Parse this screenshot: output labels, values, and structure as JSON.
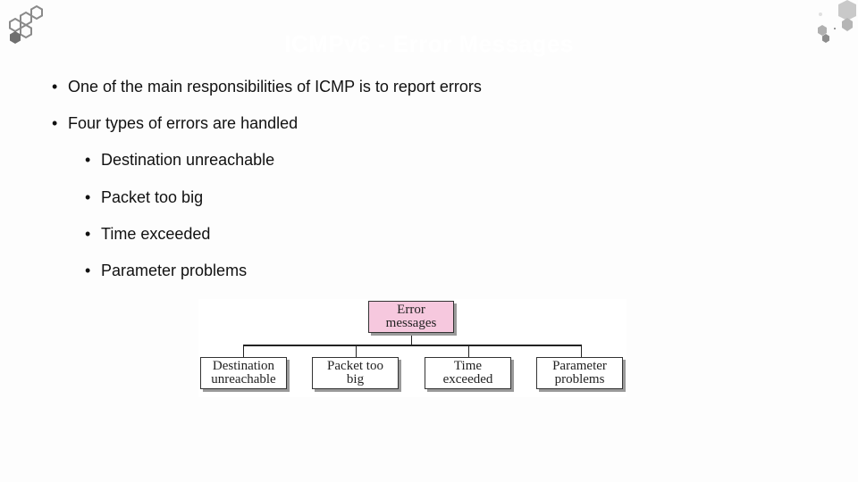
{
  "slide": {
    "title": "ICMPv6 - Error Messages",
    "bullets": [
      {
        "level": 1,
        "text": "One of the main responsibilities of ICMP is to report errors"
      },
      {
        "level": 1,
        "text": "Four types of errors are handled"
      },
      {
        "level": 2,
        "text": "Destination unreachable"
      },
      {
        "level": 2,
        "text": "Packet too big"
      },
      {
        "level": 2,
        "text": "Time exceeded"
      },
      {
        "level": 2,
        "text": "Parameter problems"
      }
    ],
    "bullet_glyph": "•"
  },
  "diagram": {
    "root": {
      "line1": "Error",
      "line2": "messages",
      "color": "#f6c8de"
    },
    "children": [
      {
        "line1": "Destination",
        "line2": "unreachable"
      },
      {
        "line1": "Packet too",
        "line2": "big"
      },
      {
        "line1": "Time",
        "line2": "exceeded"
      },
      {
        "line1": "Parameter",
        "line2": "problems"
      }
    ]
  },
  "decor": {
    "left_logo": "hexagon-cluster-icon",
    "right_logo": "hexagon-pattern-icon"
  }
}
